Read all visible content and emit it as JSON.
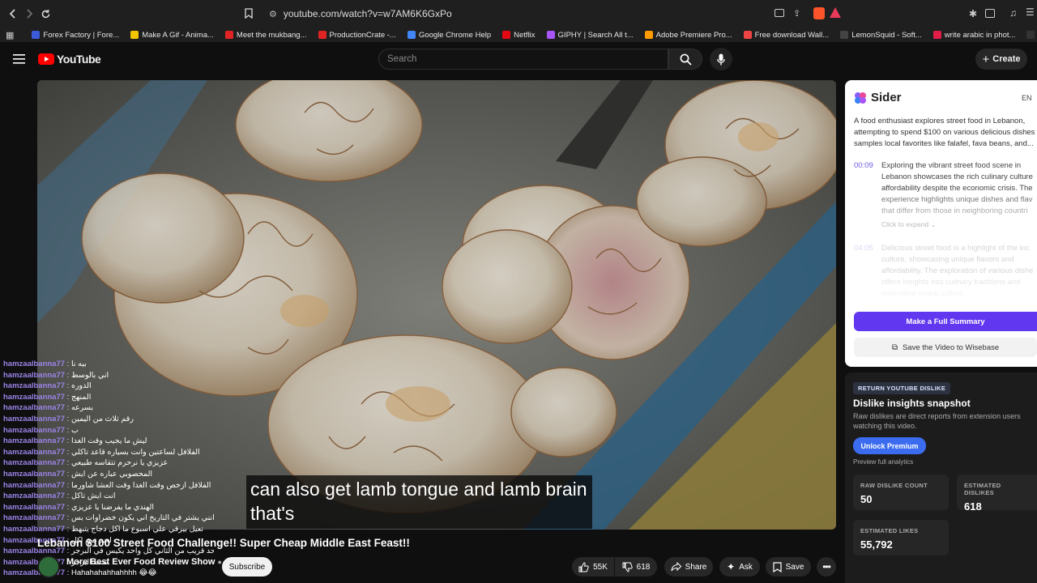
{
  "browser": {
    "url": "youtube.com/watch?v=w7AM6K6GxPo",
    "bookmarks": [
      {
        "label": "Forex Factory | Fore...",
        "color": "#3b5bdb"
      },
      {
        "label": "Make A Gif - Anima...",
        "color": "#f2c500"
      },
      {
        "label": "Meet the mukbang...",
        "color": "#e02424"
      },
      {
        "label": "ProductionCrate -...",
        "color": "#e02424"
      },
      {
        "label": "Google Chrome Help",
        "color": "#4285f4"
      },
      {
        "label": "Netflix",
        "color": "#e50914"
      },
      {
        "label": "GIPHY | Search All t...",
        "color": "#a855f7"
      },
      {
        "label": "Adobe Premiere Pro...",
        "color": "#ff9a00"
      },
      {
        "label": "Free download Wall...",
        "color": "#ef4444"
      },
      {
        "label": "LemonSquid - Soft...",
        "color": "#444444"
      },
      {
        "label": "write arabic in phot...",
        "color": "#e11d48"
      },
      {
        "label": "MATESFX - Unlimite...",
        "color": "#333333"
      }
    ]
  },
  "youtube": {
    "logo_text": "YouTube",
    "search_placeholder": "Search",
    "create_label": "Create"
  },
  "video": {
    "caption_line1": "can also get lamb tongue and lamb brain",
    "caption_line2": "that's",
    "title": "Lebanon $100 Street Food Challenge!! Super Cheap Middle East Feast!!",
    "channel": "More Best Ever Food Review Show",
    "subscribe_label": "Subscribe",
    "likes": "55K",
    "dislikes": "618",
    "share_label": "Share",
    "ask_label": "Ask",
    "save_label": "Save"
  },
  "chat": [
    {
      "user": "hamzaalbanna77",
      "msg": "بيه نا"
    },
    {
      "user": "hamzaalbanna77",
      "msg": "اني بالوسط"
    },
    {
      "user": "hamzaalbanna77",
      "msg": "الدوره"
    },
    {
      "user": "hamzaalbanna77",
      "msg": "المنهج"
    },
    {
      "user": "hamzaalbanna77",
      "msg": "بسرعه"
    },
    {
      "user": "hamzaalbanna77",
      "msg": "رقم ثلاث من اليمين"
    },
    {
      "user": "hamzaalbanna77",
      "msg": "ب"
    },
    {
      "user": "hamzaalbanna77",
      "msg": "ليش ما يجيب وقت الغدا"
    },
    {
      "user": "hamzaalbanna77",
      "msg": "الفلافل لساعتين وانت بسياره قاعد تاكلي"
    },
    {
      "user": "hamzaalbanna77",
      "msg": "عزيزي يا نرحرم تتقاسه طبيعي"
    },
    {
      "user": "hamzaalbanna77",
      "msg": "المحصوبي عباره عن ايش"
    },
    {
      "user": "hamzaalbanna77",
      "msg": "الفلافل ازخص وقت الغدا وقت العشا شاورما"
    },
    {
      "user": "hamzaalbanna77",
      "msg": "انت ايش تاكل"
    },
    {
      "user": "hamzaalbanna77",
      "msg": "الهندي ما يفرضنا يا عزيزي"
    },
    {
      "user": "hamzaalbanna77",
      "msg": "انني يشتر في التاريخ اني يكون خضراوات بس"
    },
    {
      "user": "hamzaalbanna77",
      "msg": "تعيل بيرقي علي اسبوع ما اكل دجاج يتبهط"
    },
    {
      "user": "hamzaalbanna77",
      "msg": "لحم بس اكل"
    },
    {
      "user": "hamzaalbanna77",
      "msg": "البرجر ولا عمري شفت حد قريب من الثاني كل واحد يكيس في البرجر"
    },
    {
      "user": "hamzaalbanna77",
      "msg": "تحت البرجر"
    },
    {
      "user": "hamzaalbanna77",
      "msg": "Hahahahahhahhhh 😂😂"
    }
  ],
  "sider": {
    "brand": "Sider",
    "lang": "EN",
    "summary": [
      "A food enthusiast explores street food in Lebanon,",
      "attempting to spend $100 on various delicious dishes",
      "samples local favorites like falafel, fava beans, and..."
    ],
    "item1_time": "00:09",
    "item1_lines": [
      "Exploring the vibrant street food scene in",
      "Lebanon showcases the rich culinary culture",
      "affordability despite the economic crisis. The",
      "experience highlights unique dishes and flav",
      "that differ from those in neighboring countri"
    ],
    "item1_expand": "Click to expand ⌄",
    "item2_time": "04:05",
    "item2_lines": [
      "Delicious street food is a highlight of the loc",
      "culture, showcasing unique flavors and",
      "affordability. The exploration of various dishe",
      "offers insights into culinary traditions and",
      "innovative snack culture"
    ],
    "full_summary_label": "Make a Full Summary",
    "wisebase_label": "Save the Video to Wisebase",
    "accent": "#6237f0"
  },
  "ryd": {
    "badge": "RETURN YOUTUBE DISLIKE",
    "title": "Dislike insights snapshot",
    "desc": "Raw dislikes are direct reports from extension users watching this video.",
    "unlock_label": "Unlock Premium",
    "preview_label": "Preview full analytics",
    "raw_label": "RAW DISLIKE COUNT",
    "raw_value": "50",
    "est_dislikes_label": "ESTIMATED DISLIKES",
    "est_dislikes_value": "618",
    "est_likes_label": "ESTIMATED LIKES",
    "est_likes_value": "55,792"
  }
}
